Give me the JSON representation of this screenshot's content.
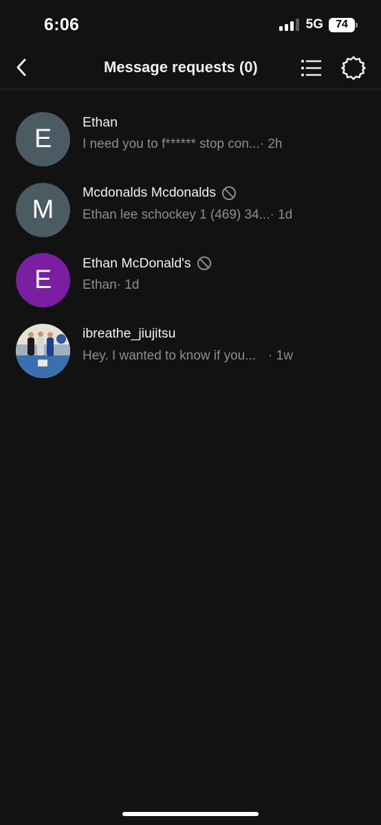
{
  "status_bar": {
    "time": "6:06",
    "network": "5G",
    "battery": "74"
  },
  "header": {
    "title": "Message requests (0)",
    "back_icon": "chevron-left-icon",
    "list_icon": "list-icon",
    "settings_icon": "gear-icon"
  },
  "requests": [
    {
      "avatar_letter": "E",
      "avatar_color": "#4a5b64",
      "name": "Ethan",
      "preview": "I need you to f****** stop con...",
      "time": " · 2h",
      "blocked": false
    },
    {
      "avatar_letter": "M",
      "avatar_color": "#4a5b64",
      "name": "Mcdonalds Mcdonalds",
      "preview": "Ethan lee schockey 1 (469) 34...",
      "time": " · 1d",
      "blocked": true
    },
    {
      "avatar_letter": "E",
      "avatar_color": "#7b1fa2",
      "name": "Ethan McDonald's",
      "preview": "Ethan",
      "time": " · 1d",
      "blocked": true
    },
    {
      "avatar_letter": "",
      "avatar_color": "#3a6fb0",
      "name": "ibreathe_jiujitsu",
      "preview": "Hey. I wanted to know if you...",
      "time": " · 1w",
      "blocked": false
    }
  ],
  "colors": {
    "background": "#121212",
    "secondary_text": "#8e8e8e"
  }
}
